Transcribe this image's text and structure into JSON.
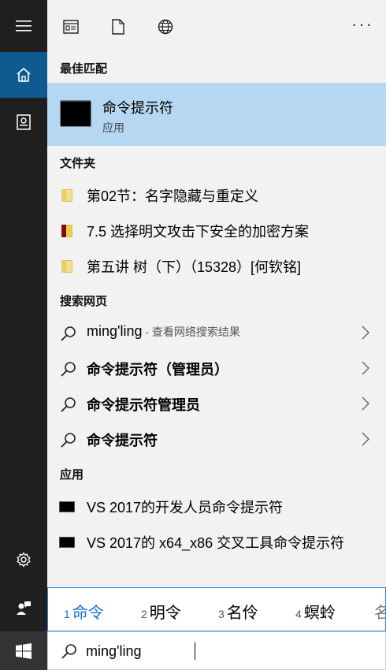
{
  "toolbar": {
    "more_label": "···"
  },
  "sections": {
    "best_match": "最佳匹配",
    "folders": "文件夹",
    "web": "搜索网页",
    "apps": "应用"
  },
  "best": {
    "title": "命令提示符",
    "subtitle": "应用"
  },
  "folders": [
    {
      "label": "第02节：名字隐藏与重定义"
    },
    {
      "label": "7.5 选择明文攻击下安全的加密方案"
    },
    {
      "label": "第五讲 树（下）（15328）[何钦铭]"
    }
  ],
  "web": [
    {
      "label": "ming'ling",
      "hint": " - 查看网络搜索结果"
    },
    {
      "label": "命令提示符（管理员）"
    },
    {
      "label": "命令提示符管理员"
    },
    {
      "label": "命令提示符"
    }
  ],
  "apps": [
    {
      "label": "VS 2017的开发人员命令提示符"
    },
    {
      "label": "VS 2017的 x64_x86 交叉工具命令提示符"
    }
  ],
  "ime": {
    "candidates": [
      {
        "num": "1",
        "text": "命令"
      },
      {
        "num": "2",
        "text": "明令"
      },
      {
        "num": "3",
        "text": "名伶"
      },
      {
        "num": "4",
        "text": "螟蛉"
      },
      {
        "num": "",
        "text": "名"
      }
    ]
  },
  "search": {
    "value": "ming'ling"
  },
  "colors": {
    "accent": "#0f5a91",
    "highlight": "#b6d7f2",
    "ime_selected": "#1570c8",
    "rail": "#1f1f1f"
  }
}
